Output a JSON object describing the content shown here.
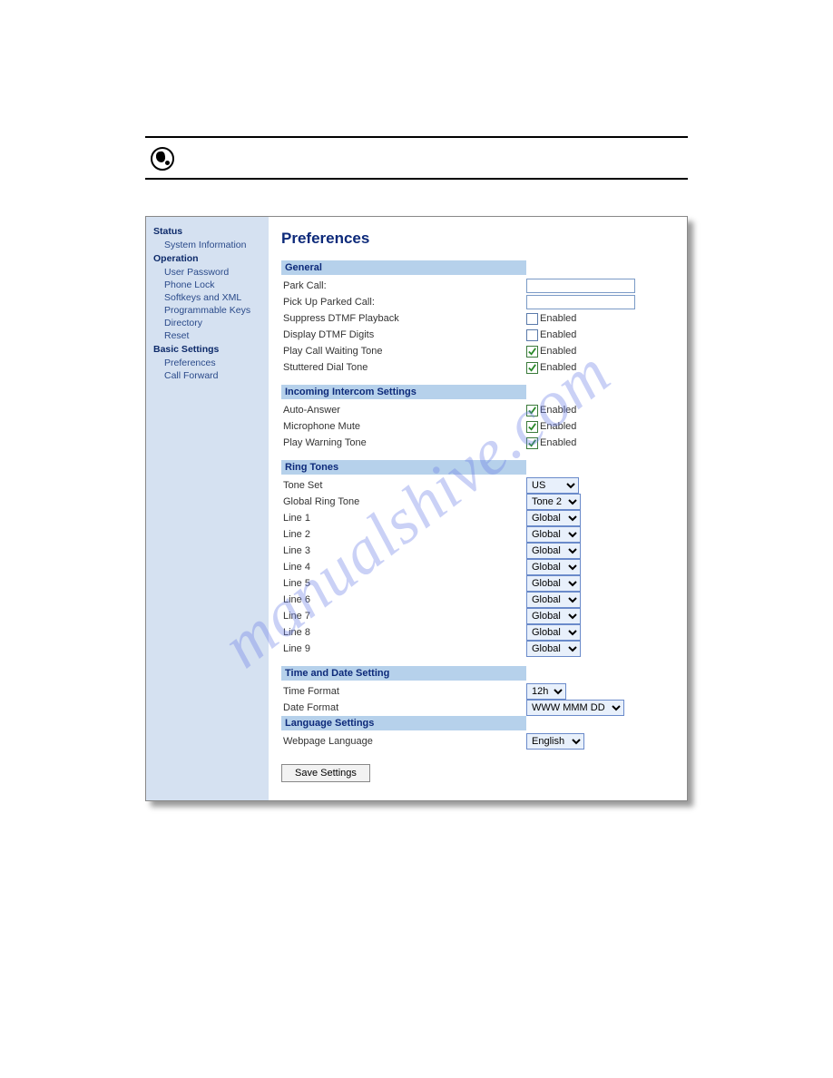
{
  "watermark": "manualshive.com",
  "sidebar": {
    "groups": [
      {
        "title": "Status",
        "items": [
          "System Information"
        ]
      },
      {
        "title": "Operation",
        "items": [
          "User Password",
          "Phone Lock",
          "Softkeys and XML",
          "Programmable Keys",
          "Directory",
          "Reset"
        ]
      },
      {
        "title": "Basic Settings",
        "items": [
          "Preferences",
          "Call Forward"
        ]
      }
    ]
  },
  "content": {
    "title": "Preferences",
    "sections": {
      "general": {
        "heading": "General",
        "park_call_label": "Park Call:",
        "park_call_value": "",
        "pickup_label": "Pick Up Parked Call:",
        "pickup_value": "",
        "suppress_dtmf_label": "Suppress DTMF Playback",
        "suppress_dtmf_checked": false,
        "display_dtmf_label": "Display DTMF Digits",
        "display_dtmf_checked": false,
        "play_cwt_label": "Play Call Waiting Tone",
        "play_cwt_checked": true,
        "stuttered_label": "Stuttered Dial Tone",
        "stuttered_checked": true,
        "enabled_text": "Enabled"
      },
      "intercom": {
        "heading": "Incoming Intercom Settings",
        "auto_answer_label": "Auto-Answer",
        "auto_answer_checked": true,
        "mic_mute_label": "Microphone Mute",
        "mic_mute_checked": true,
        "play_warn_label": "Play Warning Tone",
        "play_warn_checked": true,
        "enabled_text": "Enabled"
      },
      "ringtones": {
        "heading": "Ring Tones",
        "tone_set_label": "Tone Set",
        "tone_set_value": "US",
        "global_ring_label": "Global Ring Tone",
        "global_ring_value": "Tone 2",
        "line_value": "Global",
        "lines": [
          "Line 1",
          "Line 2",
          "Line 3",
          "Line 4",
          "Line 5",
          "Line 6",
          "Line 7",
          "Line 8",
          "Line 9"
        ]
      },
      "timedate": {
        "heading": "Time and Date Setting",
        "time_format_label": "Time Format",
        "time_format_value": "12h",
        "date_format_label": "Date Format",
        "date_format_value": "WWW MMM DD"
      },
      "language": {
        "heading": "Language Settings",
        "webpage_lang_label": "Webpage Language",
        "webpage_lang_value": "English"
      }
    },
    "save_button": "Save Settings"
  }
}
